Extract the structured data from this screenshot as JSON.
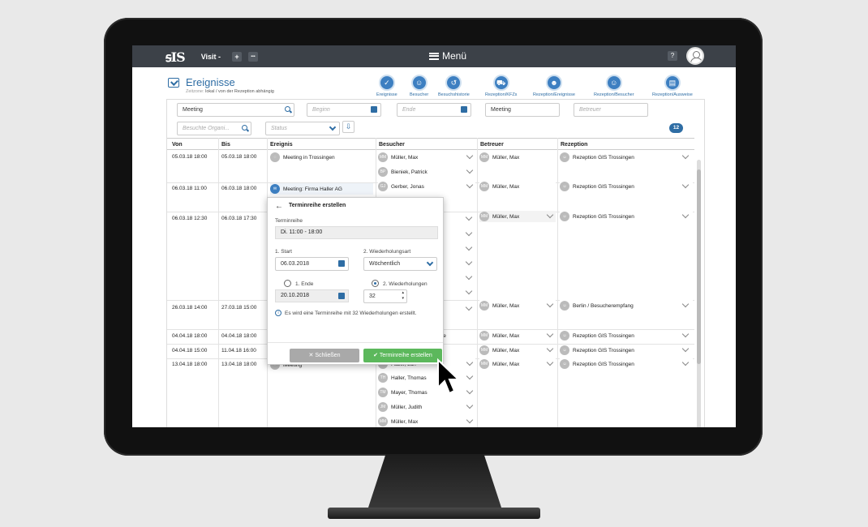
{
  "topbar": {
    "logo": "ꟊIS",
    "visit": "Visit -",
    "plus": "+",
    "more": "•••",
    "menu": "Menü",
    "help": "?"
  },
  "header": {
    "title": "Ereignisse",
    "zone_label": "Zeitzone:",
    "zone_value": "lokal / von der Rezeption abhängig"
  },
  "nav": [
    {
      "label": "Ereignisse"
    },
    {
      "label": "Besucher"
    },
    {
      "label": "Besuchshistorie"
    },
    {
      "label": "Rezeption/KFZs"
    },
    {
      "label": "Rezeption/Ereignisse"
    },
    {
      "label": "Rezeption/Besucher"
    },
    {
      "label": "Rezeption/Ausweise"
    }
  ],
  "filters": {
    "search": "Meeting",
    "begin": "Beginn",
    "end": "Ende",
    "event_type": "Meeting",
    "host": "Betreuer",
    "orgs": "Besuchte Organi...",
    "status": "Status",
    "count": "12"
  },
  "table": {
    "headers": [
      "Von",
      "Bis",
      "Ereignis",
      "Besucher",
      "Betreuer",
      "Rezeption"
    ],
    "rows": [
      {
        "von": "05.03.18 18:00",
        "bis": "05.03.18 18:00",
        "event": "Meeting in Trossingen",
        "visitors": [
          "Müller, Max",
          "Bieniek, Patrick"
        ],
        "host": "Müller, Max",
        "reception": "Rezeption GIS Trossingen"
      },
      {
        "von": "06.03.18 11:00",
        "bis": "06.03.18 18:00",
        "event": "Meeting: Firma Haller AG",
        "visitors": [
          "Gerber, Jonas"
        ],
        "host": "Müller, Max",
        "reception": "Rezeption GIS Trossingen"
      },
      {
        "von": "06.03.18 12:30",
        "bis": "06.03.18 17:30",
        "event": "",
        "visitors": [],
        "host": "Müller, Max",
        "reception": "Rezeption GIS Trossingen"
      },
      {
        "von": "26.03.18 14:00",
        "bis": "27.03.18 15:00",
        "event": "",
        "visitors": [],
        "host": "Müller, Max",
        "reception": "Berlin / Besucherempfang"
      },
      {
        "von": "04.04.18 18:00",
        "bis": "04.04.18 18:00",
        "event": "",
        "visitors": [
          "r.de"
        ],
        "host": "Müller, Max",
        "reception": "Rezeption GIS Trossingen"
      },
      {
        "von": "04.04.18 15:00",
        "bis": "11.04.18 16:00",
        "event": "",
        "visitors": [],
        "host": "Müller, Max",
        "reception": "Rezeption GIS Trossingen"
      },
      {
        "von": "13.04.18 18:00",
        "bis": "13.04.18 18:00",
        "event": "Meeting",
        "visitors": [
          "Faber, Jan",
          "Haller, Thomas",
          "Mayer, Thomas",
          "Müller, Judith",
          "Müller, Max"
        ],
        "host": "Müller, Max",
        "reception": "Rezeption GIS Trossingen"
      }
    ]
  },
  "modal": {
    "title": "Terminreihe erstellen",
    "series_label": "Terminreihe",
    "series_value": "Di. 11:00 - 18:00",
    "start_label": "1. Start",
    "start_value": "06.03.2018",
    "repeat_label": "2. Wiederholungsart",
    "repeat_value": "Wöchentlich",
    "end_label": "1. Ende",
    "end_value": "20.10.2018",
    "reps_label": "2. Wiederholungen",
    "reps_value": "32",
    "info": "Es wird eine Terminreihe mit 32 Wiederholungen erstellt.",
    "close": "Schließen",
    "create": "Terminreihe erstellen"
  },
  "colors": {
    "accent": "#2e6da4",
    "topbar": "#3c4148",
    "ok": "#5cb85c"
  }
}
